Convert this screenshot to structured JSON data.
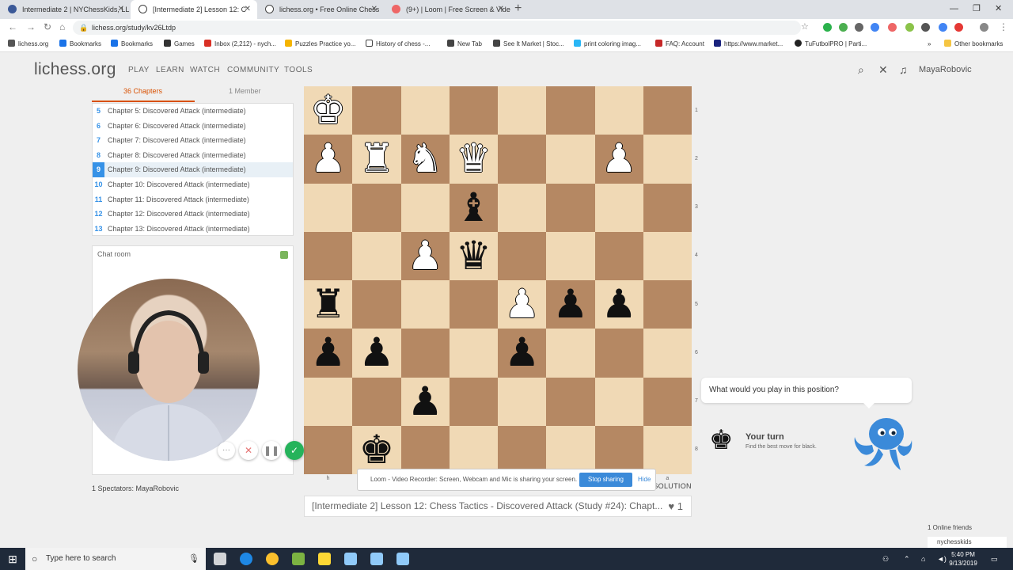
{
  "browser": {
    "tabs": [
      {
        "title": "Intermediate 2 | NYChessKids, LL",
        "active": false
      },
      {
        "title": "[Intermediate 2] Lesson 12: C",
        "active": true
      },
      {
        "title": "lichess.org • Free Online Chess",
        "active": false
      },
      {
        "title": "(9+) | Loom | Free Screen & Vide",
        "active": false
      }
    ],
    "new_tab": "+",
    "url": "lichess.org/study/kv26Ltdp",
    "bookmarks": [
      "lichess.org",
      "Bookmarks",
      "Bookmarks",
      "Games",
      "Inbox (2,212) - nych...",
      "Puzzles Practice yo...",
      "History of chess -...",
      "New Tab",
      "See It Market | Stoc...",
      "print coloring imag...",
      "FAQ: Account",
      "https://www.market...",
      "TuFutbolPRO | Parti...",
      "»",
      "Other bookmarks"
    ]
  },
  "site": {
    "logo": "lichess.org",
    "nav": [
      "PLAY",
      "LEARN",
      "WATCH",
      "COMMUNITY",
      "TOOLS"
    ],
    "user": "MayaRobovic"
  },
  "study": {
    "tab_chapters": "36 Chapters",
    "tab_members": "1 Member",
    "chapters": [
      {
        "num": "5",
        "name": "Chapter 5: Discovered Attack (intermediate)"
      },
      {
        "num": "6",
        "name": "Chapter 6: Discovered Attack (intermediate)"
      },
      {
        "num": "7",
        "name": "Chapter 7: Discovered Attack (intermediate)"
      },
      {
        "num": "8",
        "name": "Chapter 8: Discovered Attack (intermediate)"
      },
      {
        "num": "9",
        "name": "Chapter 9: Discovered Attack (intermediate)",
        "current": true
      },
      {
        "num": "10",
        "name": "Chapter 10: Discovered Attack (intermediate)"
      },
      {
        "num": "11",
        "name": "Chapter 11: Discovered Attack (intermediate)"
      },
      {
        "num": "12",
        "name": "Chapter 12: Discovered Attack (intermediate)"
      },
      {
        "num": "13",
        "name": "Chapter 13: Discovered Attack (intermediate)"
      }
    ],
    "chat_title": "Chat room",
    "spectators": "1 Spectators: MayaRobovic",
    "title": "[Intermediate 2] Lesson 12: Chess Tactics - Discovered Attack (Study #24): Chapt...",
    "likes": "1",
    "view_solution": "VIEW THE SOLUTION"
  },
  "board": {
    "ranks": [
      "1",
      "2",
      "3",
      "4",
      "5",
      "6",
      "7",
      "8"
    ],
    "files": [
      "h",
      "g",
      "f",
      "e",
      "d",
      "c",
      "b",
      "a"
    ],
    "light": "#f0d9b5",
    "dark": "#b58863",
    "pieces": [
      {
        "sq": "h1",
        "glyph": "♚",
        "color": "w"
      },
      {
        "sq": "h2",
        "glyph": "♟",
        "color": "w"
      },
      {
        "sq": "g2",
        "glyph": "♜",
        "color": "w"
      },
      {
        "sq": "f2",
        "glyph": "♞",
        "color": "w"
      },
      {
        "sq": "e2",
        "glyph": "♛",
        "color": "w"
      },
      {
        "sq": "b2",
        "glyph": "♟",
        "color": "w"
      },
      {
        "sq": "e3",
        "glyph": "♝",
        "color": "b"
      },
      {
        "sq": "f4",
        "glyph": "♟",
        "color": "w"
      },
      {
        "sq": "e4",
        "glyph": "♛",
        "color": "b"
      },
      {
        "sq": "h5",
        "glyph": "♜",
        "color": "b"
      },
      {
        "sq": "d5",
        "glyph": "♟",
        "color": "w"
      },
      {
        "sq": "c5",
        "glyph": "♟",
        "color": "b"
      },
      {
        "sq": "b5",
        "glyph": "♟",
        "color": "b"
      },
      {
        "sq": "h6",
        "glyph": "♟",
        "color": "b"
      },
      {
        "sq": "g6",
        "glyph": "♟",
        "color": "b"
      },
      {
        "sq": "d6",
        "glyph": "♟",
        "color": "b"
      },
      {
        "sq": "f7",
        "glyph": "♟",
        "color": "b"
      },
      {
        "sq": "g8",
        "glyph": "♚",
        "color": "b"
      }
    ]
  },
  "coach": {
    "question": "What would you play in this position?",
    "turn_title": "Your turn",
    "turn_sub": "Find the best move for black."
  },
  "loom": {
    "message": "Loom - Video Recorder: Screen, Webcam and Mic is sharing your screen.",
    "stop": "Stop sharing",
    "hide": "Hide"
  },
  "friends": {
    "label": "1 Online friends",
    "list": [
      "nychesskids"
    ]
  },
  "taskbar": {
    "search_placeholder": "Type here to search",
    "time": "5:40 PM",
    "date": "9/13/2019"
  }
}
